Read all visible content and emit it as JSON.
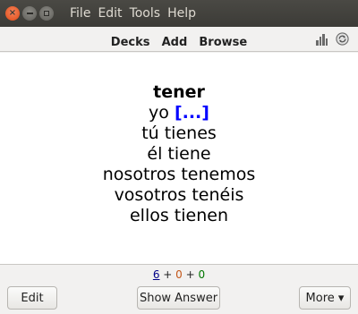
{
  "menu": {
    "file": "File",
    "edit": "Edit",
    "tools": "Tools",
    "help": "Help"
  },
  "toolbar": {
    "decks": "Decks",
    "add": "Add",
    "browse": "Browse",
    "stats_icon": "stats-icon",
    "sync_icon": "sync-icon"
  },
  "card": {
    "word": "tener",
    "line1_prefix": "yo ",
    "cloze": "[...]",
    "lines": [
      "tú tienes",
      "él tiene",
      "nosotros tenemos",
      "vosotros tenéis",
      "ellos tienen"
    ]
  },
  "counts": {
    "new": "6",
    "learn": "0",
    "review": "0",
    "sep": " + "
  },
  "buttons": {
    "edit": "Edit",
    "show_answer": "Show Answer",
    "more": "More ▾"
  },
  "colors": {
    "cloze": "#0000ff",
    "new": "#000088",
    "learn": "#c35617",
    "review": "#007700",
    "close_button": "#df4a16"
  }
}
